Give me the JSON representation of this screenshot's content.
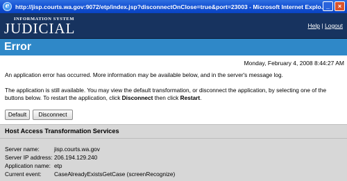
{
  "window": {
    "title": "http://jisp.courts.wa.gov:9072/etp/index.jsp?disconnectOnClose=true&port=23003 - Microsoft Internet Explo...",
    "minimize_label": "_",
    "close_label": "×"
  },
  "banner": {
    "brand_small": "INFORMATION SYSTEM",
    "brand_big": "JUDICIAL",
    "help": "Help",
    "separator": "|",
    "logout": "Logout"
  },
  "page": {
    "heading": "Error",
    "datetime": "Monday, February 4, 2008 8:44:27 AM",
    "message1": "An application error has occurred. More information may be available below, and in the server's message log.",
    "message2_pre": "The application is still available. You may view the default transformation, or disconnect the application, by selecting one of the buttons below. To restart the application, click ",
    "message2_bold1": "Disconnect",
    "message2_mid": " then click ",
    "message2_bold2": "Restart",
    "message2_post": "."
  },
  "buttons": {
    "default": "Default",
    "disconnect": "Disconnect"
  },
  "hats": {
    "title": "Host Access Transformation Services",
    "rows": [
      {
        "label": "Server name:",
        "value": "jisp.courts.wa.gov"
      },
      {
        "label": "Server IP address:",
        "value": "206.194.129.240"
      },
      {
        "label": "Application name:",
        "value": "etp"
      },
      {
        "label": "Current event:",
        "value": "CaseAlreadyExistsGetCase (screenRecognize)"
      }
    ]
  }
}
